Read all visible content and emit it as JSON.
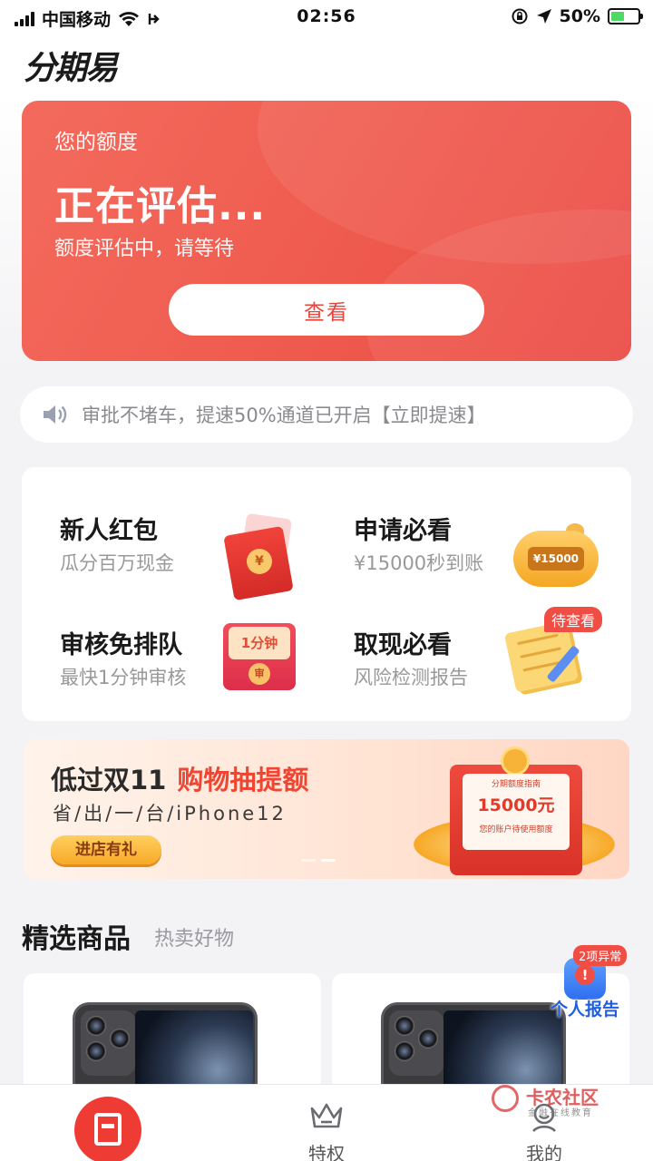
{
  "status_bar": {
    "carrier": "中国移动",
    "time": "02:56",
    "battery_percent": "50%",
    "battery_level": 0.5
  },
  "header": {
    "logo_text": "分期易"
  },
  "credit_card": {
    "label": "您的额度",
    "status": "正在评估...",
    "subtitle": "额度评估中，请等待",
    "button_label": "查看"
  },
  "notice": {
    "text": "审批不堵车，提速50%通道已开启【立即提速】"
  },
  "features": [
    {
      "title": "新人红包",
      "desc": "瓜分百万现金",
      "icon": "red-envelope-icon"
    },
    {
      "title": "申请必看",
      "desc": "¥15000秒到账",
      "icon": "piggy-bank-icon",
      "tag": "¥15000"
    },
    {
      "title": "审核免排队",
      "desc": "最快1分钟审核",
      "icon": "envelope-icon",
      "tag": "1分钟",
      "seal": "审"
    },
    {
      "title": "取现必看",
      "desc": "风险检测报告",
      "icon": "notepad-icon",
      "badge": "待查看"
    }
  ],
  "promo": {
    "title": "低过双11",
    "title_highlight": "购物抽提额",
    "subtitle": "省/出/一/台/iPhone12",
    "button_label": "进店有礼",
    "card_head": "分期额度指南",
    "card_amount": "15000元",
    "card_foot": "您的账户待使用额度"
  },
  "products_section": {
    "title": "精选商品",
    "subtitle": "热卖好物"
  },
  "float_report": {
    "badge": "2项异常",
    "label": "个人报告"
  },
  "bottom_nav": {
    "items": [
      {
        "label": "",
        "icon": "home-icon"
      },
      {
        "label": "特权",
        "icon": "crown-icon"
      },
      {
        "label": "我的",
        "icon": "user-icon"
      }
    ]
  },
  "watermark": {
    "title": "卡农社区",
    "subtitle": "金融在线教育"
  },
  "colors": {
    "accent": "#ee3c34",
    "card_gradient_start": "#f36b5d",
    "card_gradient_end": "#eb4a44",
    "background": "#f3f3f5"
  }
}
